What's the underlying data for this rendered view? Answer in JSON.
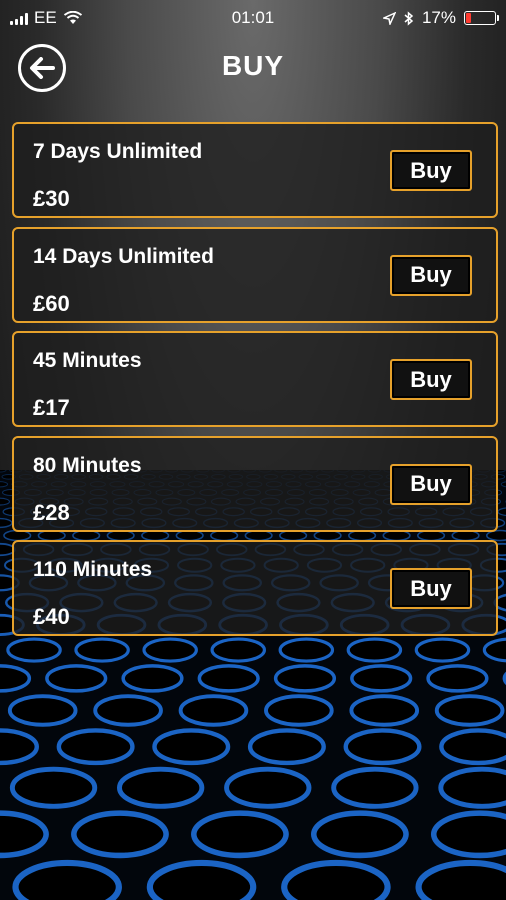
{
  "status_bar": {
    "carrier": "EE",
    "time": "01:01",
    "battery_percent": "17%",
    "battery_level": 0.17
  },
  "header": {
    "title": "BUY"
  },
  "packages": [
    {
      "name": "7 Days Unlimited",
      "price": "£30",
      "button_label": "Buy"
    },
    {
      "name": "14 Days Unlimited",
      "price": "£60",
      "button_label": "Buy"
    },
    {
      "name": "45 Minutes",
      "price": "£17",
      "button_label": "Buy"
    },
    {
      "name": "80 Minutes",
      "price": "£28",
      "button_label": "Buy"
    },
    {
      "name": "110 Minutes",
      "price": "£40",
      "button_label": "Buy"
    }
  ],
  "colors": {
    "accent": "#e6a12b",
    "floor_glow": "#1e6fd9"
  },
  "icons": {
    "back": "arrow-left-icon",
    "signal": "signal-bars-icon",
    "wifi": "wifi-icon",
    "location": "location-arrow-icon",
    "bluetooth": "bluetooth-icon",
    "battery": "battery-icon"
  }
}
